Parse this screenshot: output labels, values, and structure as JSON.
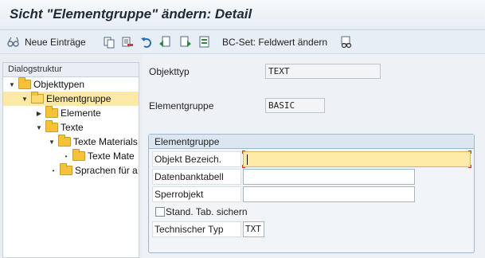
{
  "window": {
    "title": "Sicht \"Elementgruppe\" ändern: Detail"
  },
  "toolbar": {
    "items": [
      {
        "icon": "glasses-icon",
        "label": "Neue Einträge"
      },
      {
        "icon": "copy-icon",
        "label": ""
      },
      {
        "icon": "delete-icon",
        "label": ""
      },
      {
        "icon": "undo-icon",
        "label": ""
      },
      {
        "icon": "previous-entry-icon",
        "label": ""
      },
      {
        "icon": "next-entry-icon",
        "label": ""
      },
      {
        "icon": "select-all-icon",
        "label": ""
      }
    ],
    "bcset_label": "BC-Set: Feldwert ändern",
    "bcset_icon": "bcset-glasses-icon"
  },
  "dialog_structure": {
    "header": "Dialogstruktur",
    "items": [
      {
        "label": "Objekttypen",
        "level": 0,
        "expanded": true,
        "selected": false
      },
      {
        "label": "Elementgruppe",
        "level": 1,
        "expanded": true,
        "selected": true
      },
      {
        "label": "Elemente",
        "level": 2,
        "expanded": false,
        "selected": false
      },
      {
        "label": "Texte",
        "level": 2,
        "expanded": true,
        "selected": false
      },
      {
        "label": "Texte Materials",
        "level": 3,
        "expanded": true,
        "selected": false
      },
      {
        "label": "Texte Mate",
        "level": 4,
        "expanded": false,
        "selected": false
      },
      {
        "label": "Sprachen für a",
        "level": 2,
        "expanded": false,
        "selected": false
      }
    ]
  },
  "detail": {
    "objekttyp_label": "Objekttyp",
    "objekttyp_value": "TEXT",
    "elementgruppe_label": "Elementgruppe",
    "elementgruppe_value": "BASIC",
    "group": {
      "title": "Elementgruppe",
      "fields": {
        "objekt_bezeich_label": "Objekt Bezeich.",
        "objekt_bezeich_value": "",
        "datenbanktabell_label": "Datenbanktabell",
        "datenbanktabell_value": "",
        "sperrobjekt_label": "Sperrobjekt",
        "sperrobjekt_value": "",
        "stand_tab_label": "Stand. Tab. sichern",
        "stand_tab_checked": false,
        "techn_typ_label": "Technischer Typ",
        "techn_typ_value": "TXT"
      }
    }
  },
  "colors": {
    "active_field": "#fdeba7",
    "selected_tree_row": "#fde9a7",
    "folder": "#f6c23a",
    "group_border": "#9fb7cf"
  }
}
